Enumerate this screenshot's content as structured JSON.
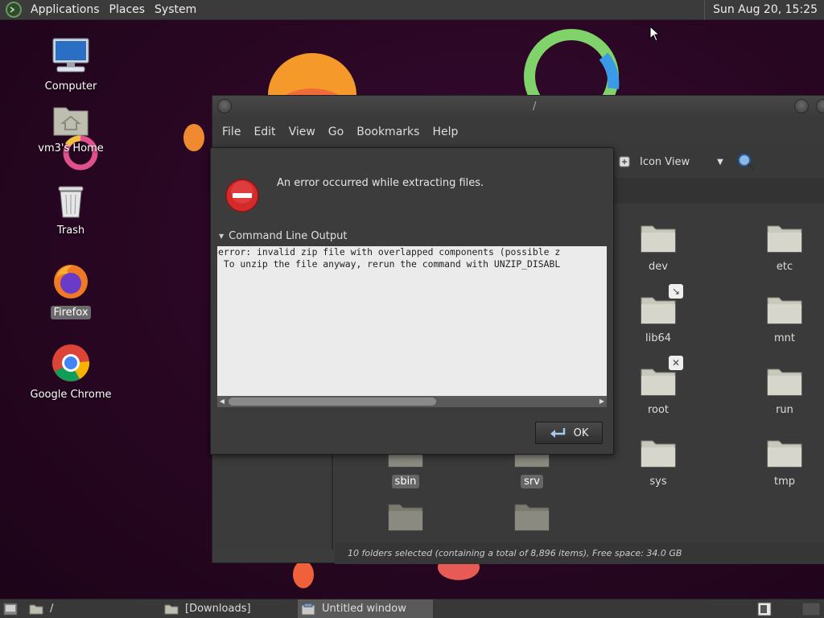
{
  "top_panel": {
    "menus": [
      "Applications",
      "Places",
      "System"
    ],
    "clock": "Sun Aug 20, 15:25"
  },
  "desktop": {
    "icons": [
      {
        "label": "Computer",
        "icon": "computer-icon"
      },
      {
        "label": "vm3's Home",
        "icon": "home-folder-icon"
      },
      {
        "label": "Trash",
        "icon": "trash-icon"
      },
      {
        "label": "Firefox",
        "icon": "firefox-icon",
        "selected": true
      },
      {
        "label": "Google Chrome",
        "icon": "chrome-icon"
      }
    ]
  },
  "file_manager": {
    "title": "/",
    "menu": [
      "File",
      "Edit",
      "View",
      "Go",
      "Bookmarks",
      "Help"
    ],
    "view_mode": "Icon View",
    "folders": [
      {
        "name": "dev"
      },
      {
        "name": "etc"
      },
      {
        "name": "lib64"
      },
      {
        "name": "mnt"
      },
      {
        "name": "root"
      },
      {
        "name": "run"
      },
      {
        "name": "sbin"
      },
      {
        "name": "srv"
      },
      {
        "name": "sys"
      },
      {
        "name": "tmp"
      }
    ],
    "status": "10 folders selected (containing a total of 8,896 items), Free space: 34.0 GB"
  },
  "error_dialog": {
    "message": "An error occurred while extracting files.",
    "expander_label": "Command Line Output",
    "output_lines": [
      "error: invalid zip file with overlapped components (possible z",
      " To unzip the file anyway, rerun the command with UNZIP_DISABL"
    ],
    "ok_label": "OK"
  },
  "taskbar": {
    "tasks": [
      {
        "label": "/"
      },
      {
        "label": "[Downloads]"
      },
      {
        "label": "Untitled window",
        "active": true
      }
    ]
  },
  "colors": {
    "error_red": "#d42a2a",
    "wallpaper": "#2a0724",
    "panel": "#3b3b3b"
  }
}
